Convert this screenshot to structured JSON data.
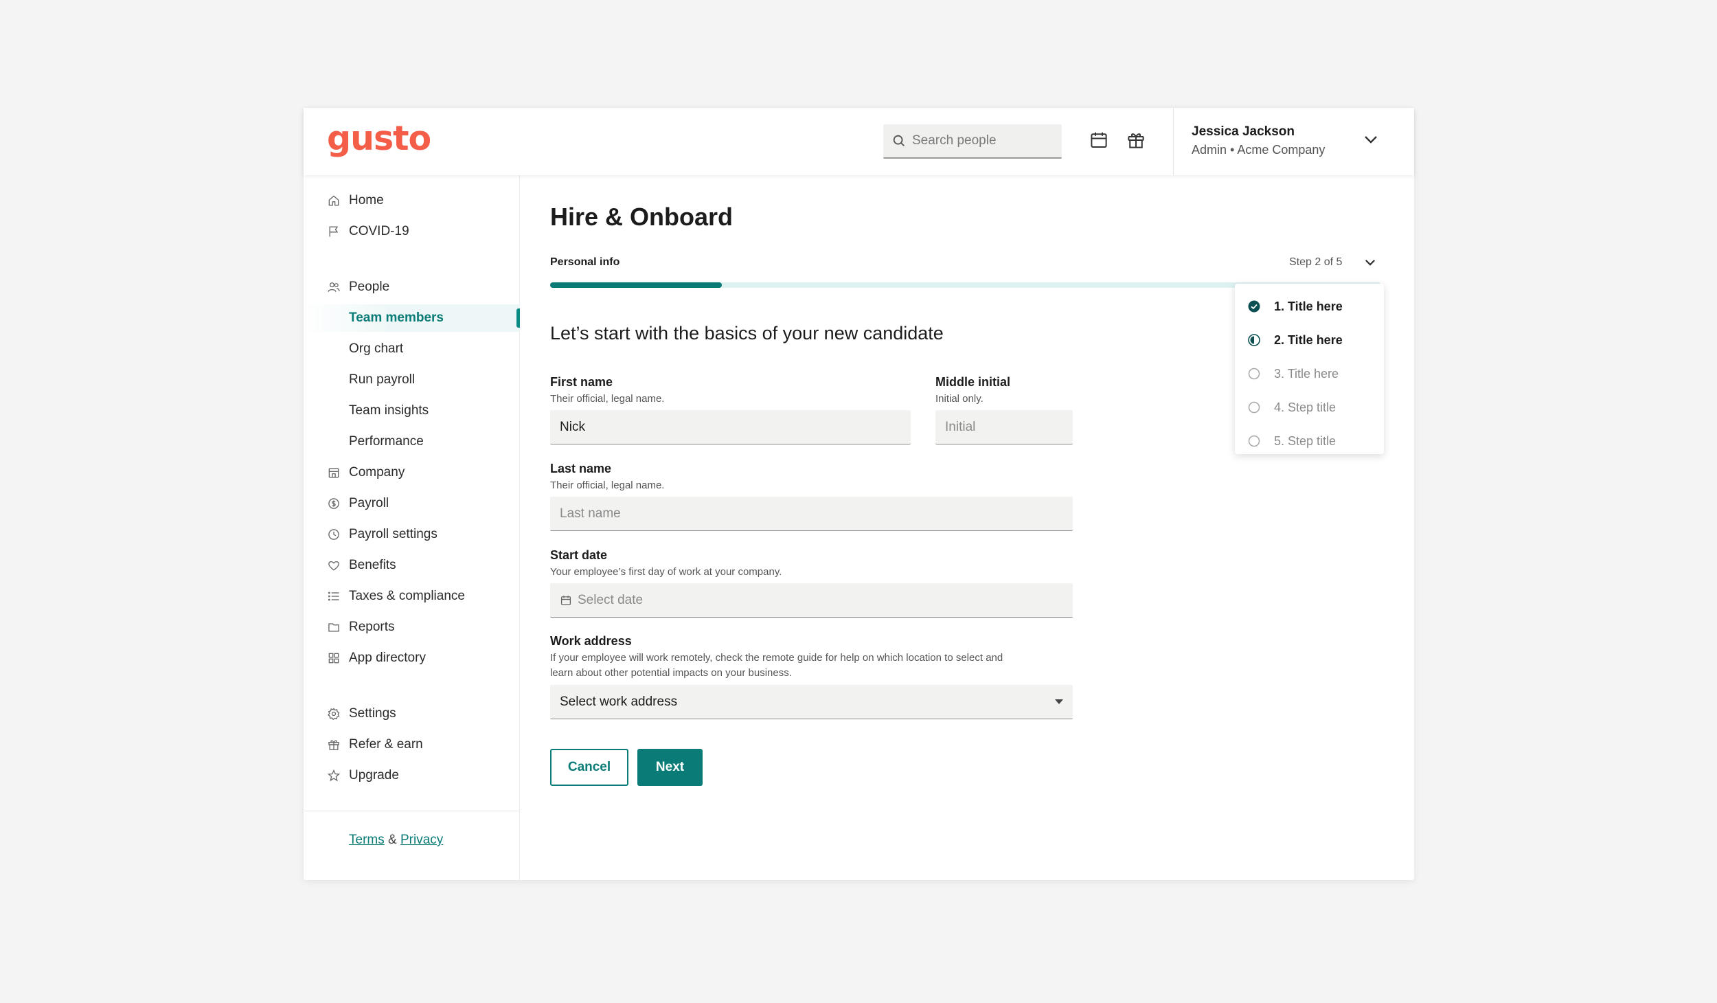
{
  "header": {
    "logo": "gusto",
    "search_placeholder": "Search people",
    "user_name": "Jessica Jackson",
    "user_role": "Admin • Acme Company"
  },
  "sidebar": {
    "items": [
      {
        "label": "Home",
        "icon": "home-icon"
      },
      {
        "label": "COVID-19",
        "icon": "flag-icon"
      },
      {
        "label": "People",
        "icon": "people-icon"
      },
      {
        "label": "Team members",
        "active": true
      },
      {
        "label": "Org chart"
      },
      {
        "label": "Run payroll"
      },
      {
        "label": "Team insights"
      },
      {
        "label": "Performance"
      },
      {
        "label": "Company",
        "icon": "building-icon"
      },
      {
        "label": "Payroll",
        "icon": "dollar-icon"
      },
      {
        "label": "Payroll settings",
        "icon": "clock-icon"
      },
      {
        "label": "Benefits",
        "icon": "heart-icon"
      },
      {
        "label": "Taxes & compliance",
        "icon": "list-icon"
      },
      {
        "label": "Reports",
        "icon": "folder-icon"
      },
      {
        "label": "App directory",
        "icon": "apps-icon"
      },
      {
        "label": "Settings",
        "icon": "gear-icon"
      },
      {
        "label": "Refer & earn",
        "icon": "gift-icon"
      },
      {
        "label": "Upgrade",
        "icon": "star-icon"
      }
    ],
    "terms": "Terms",
    "and": "&",
    "privacy": "Privacy"
  },
  "main": {
    "title": "Hire & Onboard",
    "step_label": "Personal info",
    "step_count": "Step 2 of 5",
    "progress": 0.207,
    "steps": [
      {
        "label": "1. Title here",
        "state": "done"
      },
      {
        "label": "2. Title here",
        "state": "current"
      },
      {
        "label": "3. Title here",
        "state": "todo"
      },
      {
        "label": "4. Step title",
        "state": "todo"
      },
      {
        "label": "5. Step title",
        "state": "todo"
      }
    ],
    "section_title": "Let’s start with the basics of your new candidate",
    "first_name": {
      "label": "First name",
      "help": "Their official, legal name.",
      "value": "Nick"
    },
    "middle_initial": {
      "label": "Middle initial",
      "help": "Initial only.",
      "placeholder": "Initial"
    },
    "last_name": {
      "label": "Last name",
      "help": "Their official, legal name.",
      "placeholder": "Last name"
    },
    "start_date": {
      "label": "Start date",
      "help": "Your employee’s first day of work at your company.",
      "placeholder": "Select date"
    },
    "work_address": {
      "label": "Work address",
      "help_line1": "If your employee will work remotely, check the remote guide for help on which location to select and",
      "help_line2": "learn about other potential impacts on your business.",
      "value": "Select work address"
    },
    "cancel_label": "Cancel",
    "next_label": "Next"
  },
  "colors": {
    "brand": "#f45d48",
    "accent": "#0a7b76",
    "progress_track": "#ddf1f1"
  }
}
